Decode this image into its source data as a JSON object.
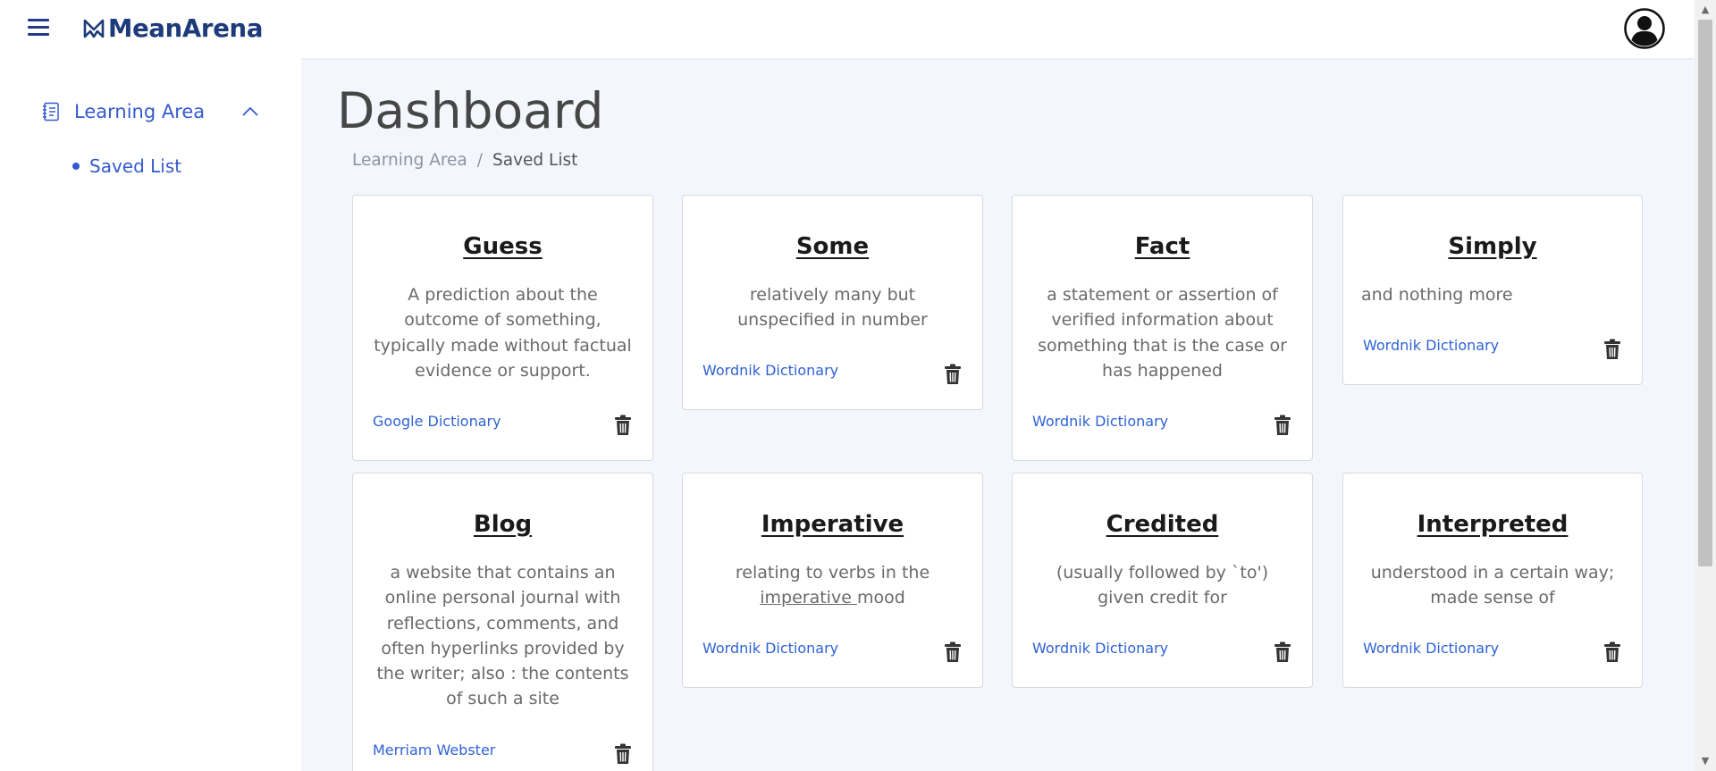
{
  "brand": {
    "name": "MeanArena",
    "logo_icon": "meanarena-logo-icon"
  },
  "header": {
    "menu_icon": "hamburger-menu-icon",
    "avatar_icon": "user-avatar-icon"
  },
  "sidebar": {
    "group_label": "Learning Area",
    "group_icon": "notebook-icon",
    "group_expanded": true,
    "items": [
      {
        "label": "Saved List",
        "active": true
      }
    ]
  },
  "main": {
    "title": "Dashboard",
    "breadcrumb": {
      "parent": "Learning Area",
      "separator": "/",
      "current": "Saved List"
    }
  },
  "cards": [
    {
      "word": "Guess",
      "definition": "A prediction about the outcome of something, typically made without factual evidence or support.",
      "source": "Google Dictionary"
    },
    {
      "word": "Some",
      "definition": "relatively many but unspecified in number",
      "source": "Wordnik Dictionary"
    },
    {
      "word": "Fact",
      "definition": "a statement or assertion of verified information about something that is the case or has happened",
      "source": "Wordnik Dictionary"
    },
    {
      "word": "Simply",
      "definition": "and nothing more",
      "source": "Wordnik Dictionary"
    },
    {
      "word": "Blog",
      "definition": "a website that contains an online personal journal with reflections, comments, and often hyperlinks provided by the writer; also : the contents of such a site",
      "source": "Merriam Webster"
    },
    {
      "word": "Imperative",
      "definition_prefix": "relating to verbs in the",
      "definition_link": "imperative ",
      "definition_suffix": "mood",
      "source": "Wordnik Dictionary"
    },
    {
      "word": "Credited",
      "definition": "(usually followed by `to') given credit for",
      "source": "Wordnik Dictionary"
    },
    {
      "word": "Interpreted",
      "definition": "understood in a certain way; made sense of",
      "source": "Wordnik Dictionary"
    }
  ],
  "colors": {
    "accent": "#3559d0",
    "brand": "#1d3a7a",
    "link": "#2f62d6",
    "background": "#f3f6fc"
  }
}
